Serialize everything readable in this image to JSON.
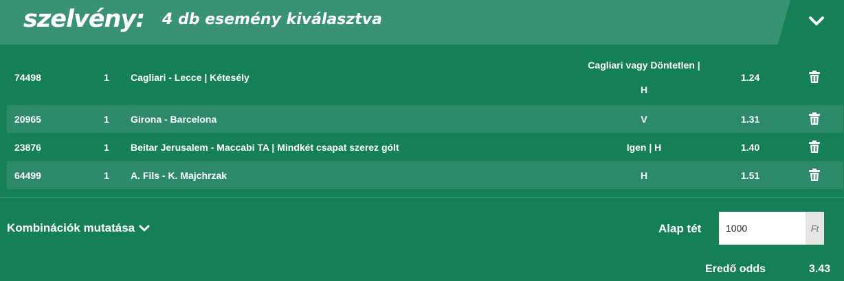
{
  "header": {
    "brand": "szelvény:",
    "subtitle": "4 db esemény kiválasztva",
    "collapse_icon": "chevron-down-icon"
  },
  "bets": [
    {
      "id": "74498",
      "count": "1",
      "event": "Cagliari - Lecce | Kétesély",
      "tip_line1": "Cagliari vagy Döntetlen |",
      "tip_line2": "H",
      "odds": "1.24"
    },
    {
      "id": "20965",
      "count": "1",
      "event": "Girona - Barcelona",
      "tip_line1": "V",
      "tip_line2": "",
      "odds": "1.31"
    },
    {
      "id": "23876",
      "count": "1",
      "event": "Beitar Jerusalem - Maccabi TA | Mindkét csapat szerez gólt",
      "tip_line1": "Igen | H",
      "tip_line2": "",
      "odds": "1.40"
    },
    {
      "id": "64499",
      "count": "1",
      "event": "A. Fils - K. Majchrzak",
      "tip_line1": "H",
      "tip_line2": "",
      "odds": "1.51"
    }
  ],
  "footer": {
    "combinations_label": "Kombinációk mutatása",
    "stake_label": "Alap tét",
    "stake_value": "1000",
    "stake_unit": "Ft",
    "total_odds_label": "Eredő odds",
    "total_odds_value": "3.43"
  },
  "colors": {
    "background": "#157f56",
    "header_band": "#3a9275",
    "row_alt": "#2d8a69"
  }
}
